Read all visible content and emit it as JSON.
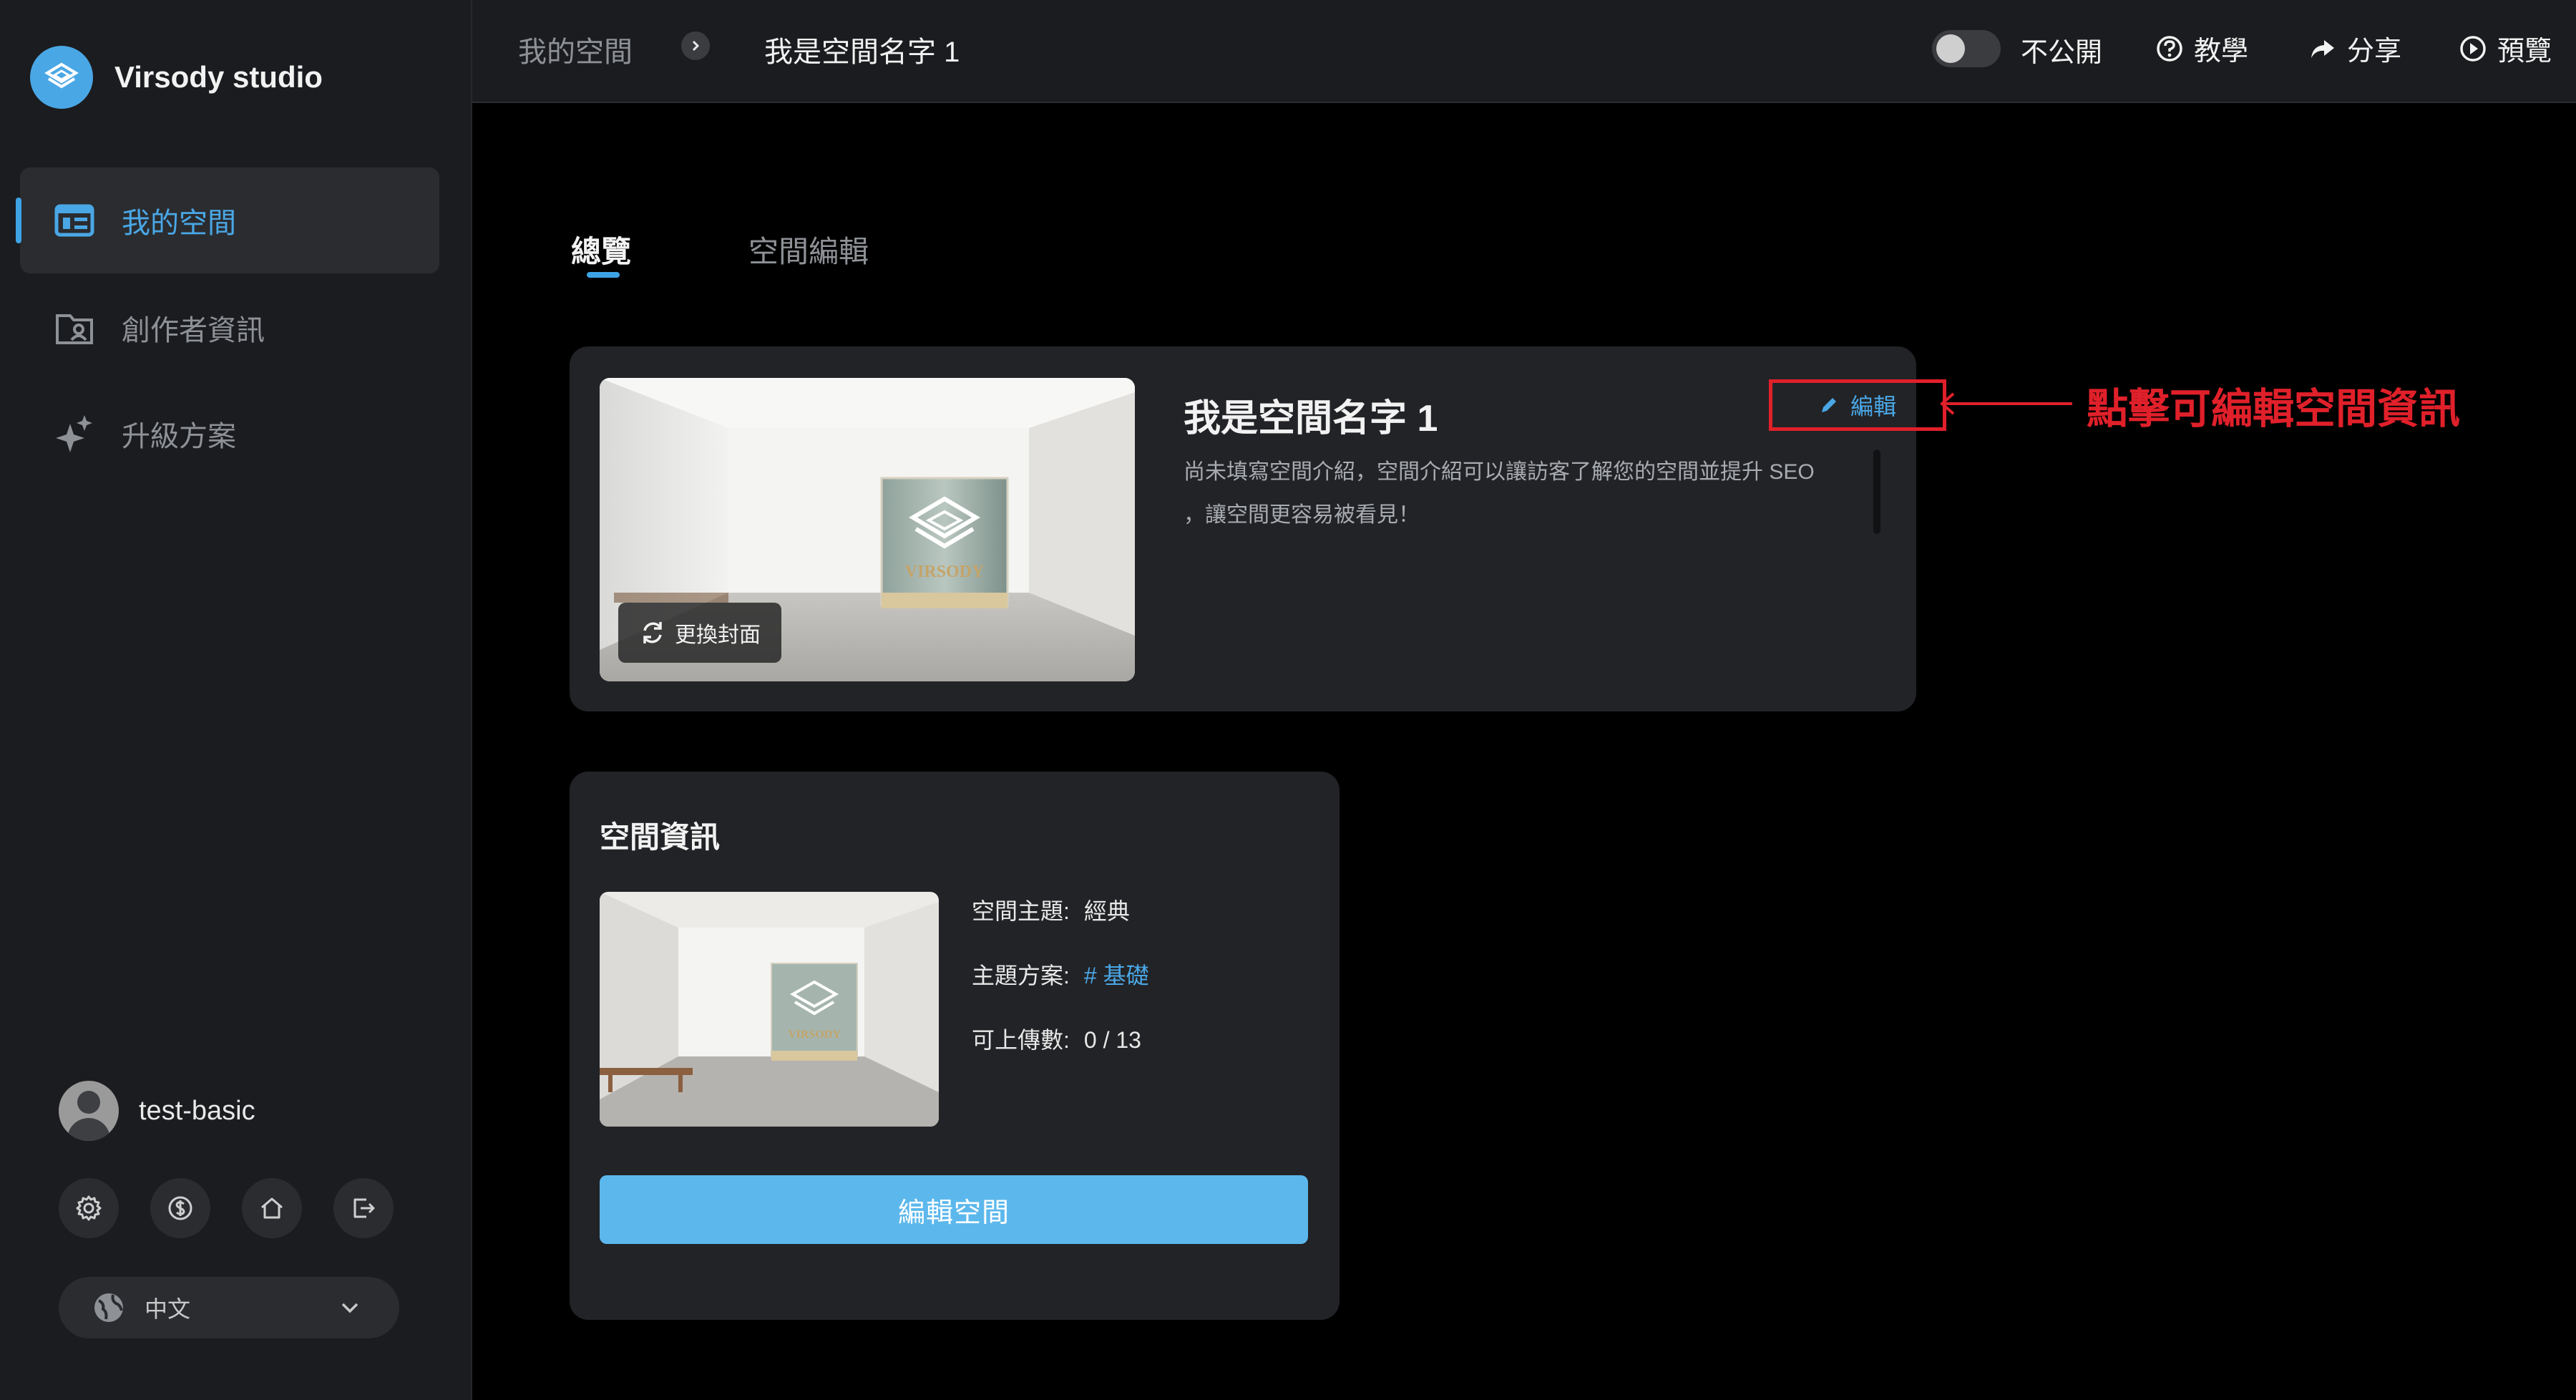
{
  "brand": {
    "name": "Virsody studio"
  },
  "sidebar": {
    "items": [
      {
        "label": "我的空間",
        "icon": "dashboard-icon",
        "active": true
      },
      {
        "label": "創作者資訊",
        "icon": "folder-user-icon",
        "active": false
      },
      {
        "label": "升級方案",
        "icon": "sparkle-icon",
        "active": false
      }
    ],
    "user": {
      "name": "test-basic"
    },
    "actions": [
      "settings-icon",
      "dollar-icon",
      "home-icon",
      "logout-icon"
    ],
    "language": {
      "value": "中文"
    }
  },
  "topbar": {
    "breadcrumb": [
      "我的空間",
      "我是空間名字 1"
    ],
    "visibility_label": "不公開",
    "visibility_on": false,
    "tutorial_label": "教學",
    "share_label": "分享",
    "preview_label": "預覽"
  },
  "tabs": [
    {
      "label": "總覽",
      "active": true
    },
    {
      "label": "空間編輯",
      "active": false
    }
  ],
  "overview": {
    "title": "我是空間名字 1",
    "edit_label": "編輯",
    "description": "尚未填寫空間介紹，空間介紹可以讓訪客了解您的空間並提升 SEO ，讓空間更容易被看見！",
    "change_cover_label": "更換封面",
    "cover_logo_text": "VIRSODY"
  },
  "annotation": {
    "text": "點擊可編輯空間資訊",
    "color": "#e0202a"
  },
  "space_info": {
    "title": "空間資訊",
    "theme_label": "空間主題:",
    "theme_value": "經典",
    "plan_label": "主題方案:",
    "plan_value": "# 基礎",
    "uploads_label": "可上傳數:",
    "uploads_value": "0 / 13",
    "edit_button": "編輯空間"
  },
  "colors": {
    "accent": "#4aa7e6",
    "button": "#5cb8ec",
    "annotation": "#e0202a"
  }
}
